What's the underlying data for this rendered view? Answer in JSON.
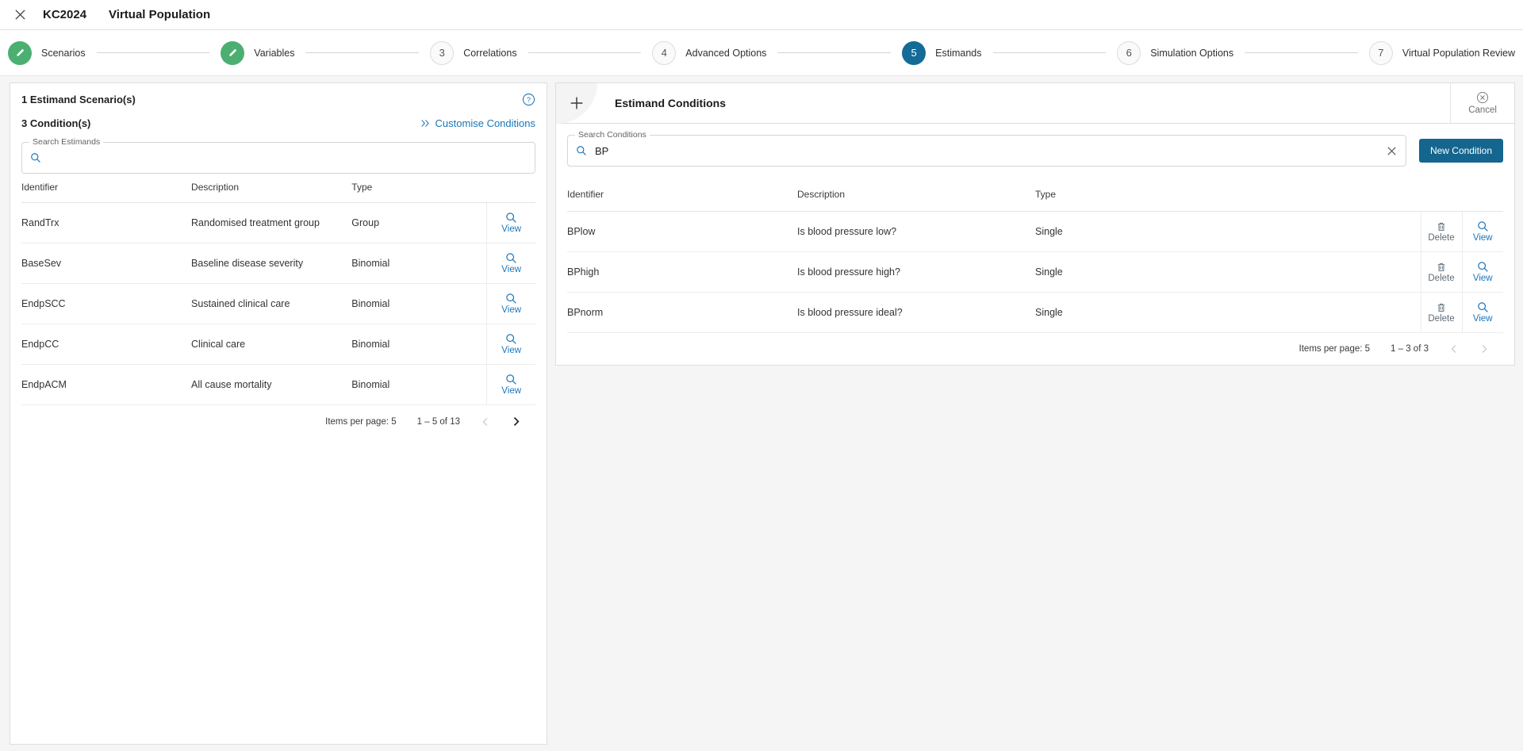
{
  "titlebar": {
    "close_icon": "close-icon",
    "app_code": "KC2024",
    "app_title": "Virtual Population"
  },
  "stepper": {
    "steps": [
      {
        "number": "1",
        "label": "Scenarios",
        "state": "done",
        "glyph": "pencil-icon"
      },
      {
        "number": "2",
        "label": "Variables",
        "state": "done",
        "glyph": "pencil-icon"
      },
      {
        "number": "3",
        "label": "Correlations",
        "state": "todo"
      },
      {
        "number": "4",
        "label": "Advanced Options",
        "state": "todo"
      },
      {
        "number": "5",
        "label": "Estimands",
        "state": "active"
      },
      {
        "number": "6",
        "label": "Simulation Options",
        "state": "todo"
      },
      {
        "number": "7",
        "label": "Virtual Population Review",
        "state": "todo"
      }
    ],
    "active_color": "#136b96",
    "done_color": "#4caf72"
  },
  "left_panel": {
    "scenario_count_label": "1 Estimand Scenario(s)",
    "condition_count_label": "3 Condition(s)",
    "help_icon": "help-circle-icon",
    "customise_link": "Customise Conditions",
    "search": {
      "legend": "Search Estimands",
      "value": "",
      "placeholder": ""
    },
    "table": {
      "columns": [
        "Identifier",
        "Description",
        "Type"
      ],
      "rows": [
        {
          "identifier": "RandTrx",
          "description": "Randomised treatment group",
          "type": "Group",
          "action": "View"
        },
        {
          "identifier": "BaseSev",
          "description": "Baseline disease severity",
          "type": "Binomial",
          "action": "View"
        },
        {
          "identifier": "EndpSCC",
          "description": "Sustained clinical care",
          "type": "Binomial",
          "action": "View"
        },
        {
          "identifier": "EndpCC",
          "description": "Clinical care",
          "type": "Binomial",
          "action": "View"
        },
        {
          "identifier": "EndpACM",
          "description": "All cause mortality",
          "type": "Binomial",
          "action": "View"
        }
      ]
    },
    "paginator": {
      "items_per_page_label": "Items per page: 5",
      "range_label": "1 – 5 of 13",
      "prev_enabled": false,
      "next_enabled": true
    }
  },
  "right_panel": {
    "add_icon": "plus-icon",
    "title": "Estimand Conditions",
    "cancel": {
      "label": "Cancel",
      "icon": "close-circle-icon"
    },
    "search": {
      "legend": "Search Conditions",
      "value": "BP",
      "placeholder": "",
      "clear_icon": "clear-icon"
    },
    "new_condition_button": "New Condition",
    "table": {
      "columns": [
        "Identifier",
        "Description",
        "Type"
      ],
      "rows": [
        {
          "identifier": "BPlow",
          "description": "Is blood pressure low?",
          "type": "Single",
          "delete": "Delete",
          "view": "View"
        },
        {
          "identifier": "BPhigh",
          "description": "Is blood pressure high?",
          "type": "Single",
          "delete": "Delete",
          "view": "View"
        },
        {
          "identifier": "BPnorm",
          "description": "Is blood pressure ideal?",
          "type": "Single",
          "delete": "Delete",
          "view": "View"
        }
      ]
    },
    "paginator": {
      "items_per_page_label": "Items per page: 5",
      "range_label": "1 – 3 of 3",
      "prev_enabled": false,
      "next_enabled": false
    }
  }
}
